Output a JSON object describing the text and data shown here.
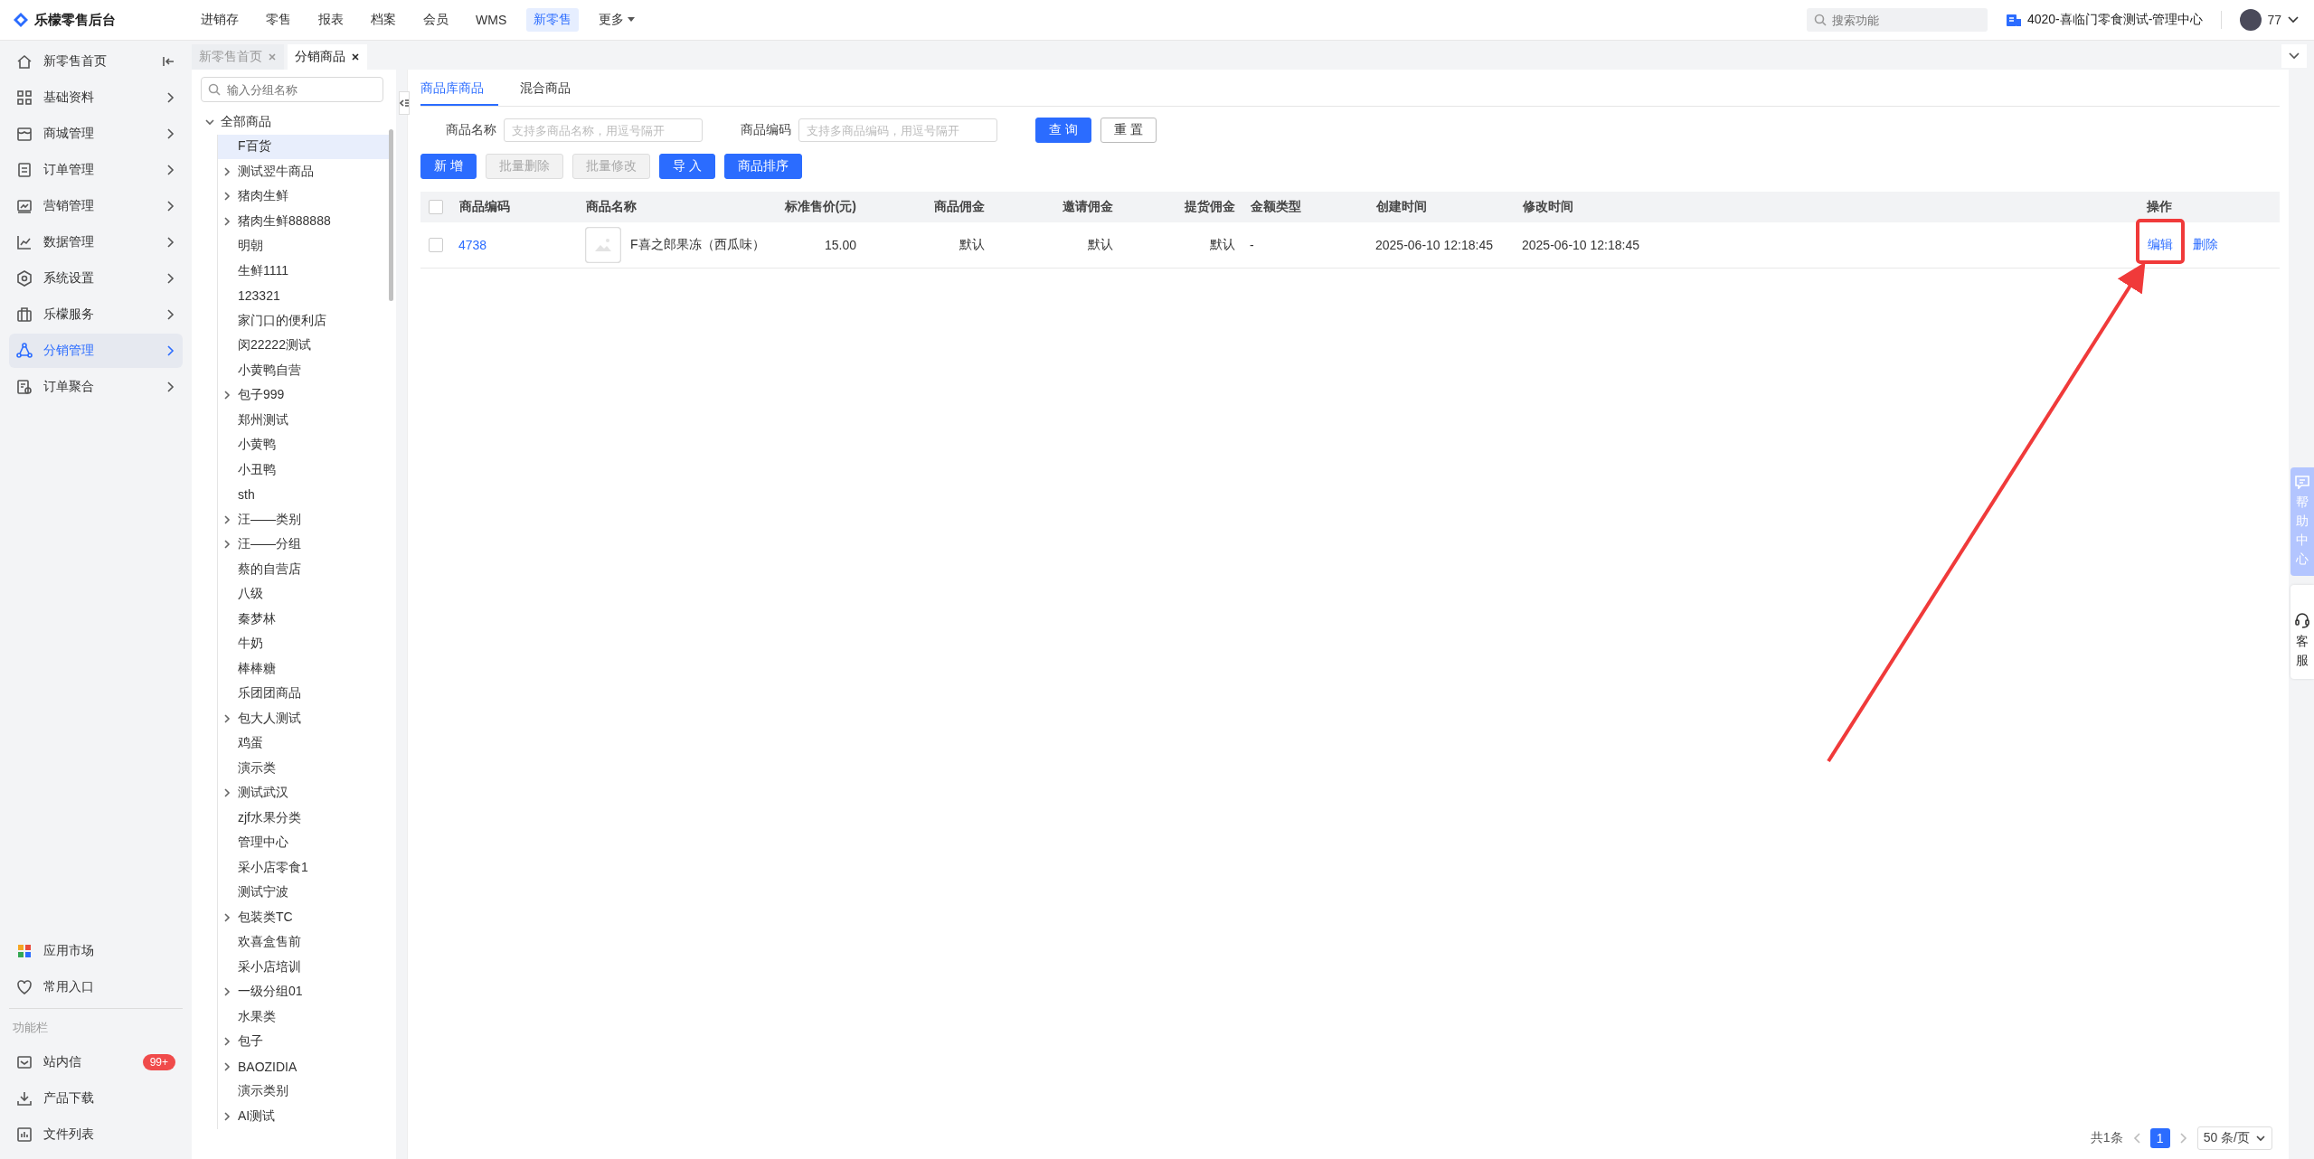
{
  "app": {
    "title": "乐檬零售后台"
  },
  "top_nav": [
    {
      "label": "进销存",
      "selected": false,
      "kind": "link"
    },
    {
      "label": "零售",
      "selected": false,
      "kind": "link"
    },
    {
      "label": "报表",
      "selected": false,
      "kind": "link"
    },
    {
      "label": "档案",
      "selected": false,
      "kind": "link"
    },
    {
      "label": "会员",
      "selected": false,
      "kind": "link"
    },
    {
      "label": "WMS",
      "selected": false,
      "kind": "link"
    },
    {
      "label": "新零售",
      "selected": true,
      "kind": "link"
    },
    {
      "label": "更多",
      "selected": false,
      "kind": "dropdown"
    }
  ],
  "global_search": {
    "placeholder": "搜索功能"
  },
  "store": {
    "name": "4020-喜临门零食测试-管理中心"
  },
  "user": {
    "name": "77"
  },
  "sidebar": {
    "items": [
      {
        "label": "新零售首页",
        "selected": false,
        "kind": "home"
      },
      {
        "label": "基础资料",
        "selected": false,
        "kind": "menu"
      },
      {
        "label": "商城管理",
        "selected": false,
        "kind": "menu"
      },
      {
        "label": "订单管理",
        "selected": false,
        "kind": "menu"
      },
      {
        "label": "营销管理",
        "selected": false,
        "kind": "menu"
      },
      {
        "label": "数据管理",
        "selected": false,
        "kind": "menu"
      },
      {
        "label": "系统设置",
        "selected": false,
        "kind": "menu"
      },
      {
        "label": "乐檬服务",
        "selected": false,
        "kind": "menu"
      },
      {
        "label": "分销管理",
        "selected": true,
        "kind": "menu"
      },
      {
        "label": "订单聚合",
        "selected": false,
        "kind": "menu"
      }
    ],
    "bottom_items": [
      {
        "label": "应用市场"
      },
      {
        "label": "常用入口"
      }
    ],
    "section_title": "功能栏",
    "function_items": [
      {
        "label": "站内信",
        "badge": "99+"
      },
      {
        "label": "产品下载"
      },
      {
        "label": "文件列表"
      }
    ]
  },
  "page_tabs": [
    {
      "label": "新零售首页",
      "selected": false
    },
    {
      "label": "分销商品",
      "selected": true
    }
  ],
  "group_tree": {
    "search_placeholder": "输入分组名称",
    "root": {
      "label": "全部商品",
      "expanded": true,
      "children": [
        {
          "label": "F百货",
          "kind": "leaf",
          "selected": true
        },
        {
          "label": "测试翌牛商品",
          "kind": "branch",
          "expanded": false,
          "selected": false
        },
        {
          "label": "猪肉生鲜",
          "kind": "branch",
          "expanded": false,
          "selected": false
        },
        {
          "label": "猪肉生鲜888888",
          "kind": "branch",
          "expanded": false,
          "selected": false
        },
        {
          "label": "明朝",
          "kind": "leaf",
          "selected": false
        },
        {
          "label": "生鲜1111",
          "kind": "leaf",
          "selected": false
        },
        {
          "label": "123321",
          "kind": "leaf",
          "selected": false
        },
        {
          "label": "家门口的便利店",
          "kind": "leaf",
          "selected": false
        },
        {
          "label": "闵22222测试",
          "kind": "leaf",
          "selected": false
        },
        {
          "label": "小黄鸭自营",
          "kind": "leaf",
          "selected": false
        },
        {
          "label": "包子999",
          "kind": "branch",
          "expanded": false,
          "selected": false
        },
        {
          "label": "郑州测试",
          "kind": "leaf",
          "selected": false
        },
        {
          "label": "小黄鸭",
          "kind": "leaf",
          "selected": false
        },
        {
          "label": "小丑鸭",
          "kind": "leaf",
          "selected": false
        },
        {
          "label": "sth",
          "kind": "leaf",
          "selected": false
        },
        {
          "label": "汪——类别",
          "kind": "branch",
          "expanded": false,
          "selected": false
        },
        {
          "label": "汪——分组",
          "kind": "branch",
          "expanded": false,
          "selected": false
        },
        {
          "label": "蔡的自营店",
          "kind": "leaf",
          "selected": false
        },
        {
          "label": "八级",
          "kind": "leaf",
          "selected": false
        },
        {
          "label": "秦梦林",
          "kind": "leaf",
          "selected": false
        },
        {
          "label": "牛奶",
          "kind": "leaf",
          "selected": false
        },
        {
          "label": "棒棒糖",
          "kind": "leaf",
          "selected": false
        },
        {
          "label": "乐团团商品",
          "kind": "leaf",
          "selected": false
        },
        {
          "label": "包大人测试",
          "kind": "branch",
          "expanded": false,
          "selected": false
        },
        {
          "label": "鸡蛋",
          "kind": "leaf",
          "selected": false
        },
        {
          "label": "演示类",
          "kind": "leaf",
          "selected": false
        },
        {
          "label": "测试武汉",
          "kind": "branch",
          "expanded": false,
          "selected": false
        },
        {
          "label": "zjf水果分类",
          "kind": "leaf",
          "selected": false
        },
        {
          "label": "管理中心",
          "kind": "leaf",
          "selected": false
        },
        {
          "label": "采小店零食1",
          "kind": "leaf",
          "selected": false
        },
        {
          "label": "测试宁波",
          "kind": "leaf",
          "selected": false
        },
        {
          "label": "包装类TC",
          "kind": "branch",
          "expanded": false,
          "selected": false
        },
        {
          "label": "欢喜盒售前",
          "kind": "leaf",
          "selected": false
        },
        {
          "label": "采小店培训",
          "kind": "leaf",
          "selected": false
        },
        {
          "label": "一级分组01",
          "kind": "branch",
          "expanded": false,
          "selected": false
        },
        {
          "label": "水果类",
          "kind": "leaf",
          "selected": false
        },
        {
          "label": "包子",
          "kind": "branch",
          "expanded": false,
          "selected": false
        },
        {
          "label": "BAOZIDIA",
          "kind": "branch",
          "expanded": false,
          "selected": false
        },
        {
          "label": "演示类别",
          "kind": "leaf",
          "selected": false
        },
        {
          "label": "AI测试",
          "kind": "branch",
          "expanded": false,
          "selected": false
        }
      ]
    }
  },
  "content_tabs": [
    {
      "label": "商品库商品",
      "selected": true
    },
    {
      "label": "混合商品",
      "selected": false
    }
  ],
  "filters": [
    {
      "label": "商品名称",
      "placeholder": "支持多商品名称，用逗号隔开"
    },
    {
      "label": "商品编码",
      "placeholder": "支持多商品编码，用逗号隔开"
    }
  ],
  "filter_buttons": [
    {
      "label": "查 询",
      "kind": "primary"
    },
    {
      "label": "重 置",
      "kind": "default"
    }
  ],
  "toolbar_buttons": [
    {
      "label": "新 增",
      "disabled": false
    },
    {
      "label": "批量删除",
      "disabled": true
    },
    {
      "label": "批量修改",
      "disabled": true
    },
    {
      "label": "导 入",
      "disabled": false
    },
    {
      "label": "商品排序",
      "disabled": false
    }
  ],
  "table": {
    "header_checked": false,
    "columns": [
      {
        "label": "商品编码"
      },
      {
        "label": "商品名称"
      },
      {
        "label": "标准售价(元)"
      },
      {
        "label": "商品佣金"
      },
      {
        "label": "邀请佣金"
      },
      {
        "label": "提货佣金"
      },
      {
        "label": "金额类型"
      },
      {
        "label": "创建时间"
      },
      {
        "label": "修改时间"
      },
      {
        "label": "操作"
      }
    ],
    "rows": [
      {
        "checked": false,
        "code": "4738",
        "name": "F喜之郎果冻（西瓜味）",
        "price": "15.00",
        "commission": "默认",
        "invite_commission": "默认",
        "pickup_commission": "默认",
        "amount_type": "-",
        "created": "2025-06-10 12:18:45",
        "modified": "2025-06-10 12:18:45",
        "actions": [
          {
            "label": "编辑"
          },
          {
            "label": "删除"
          }
        ]
      }
    ]
  },
  "pagination": {
    "total": "共1条",
    "pages": [
      {
        "label": "1",
        "selected": true
      }
    ],
    "page_size": "50 条/页"
  },
  "help_panel": {
    "help": "帮助中心",
    "service": "客服"
  }
}
